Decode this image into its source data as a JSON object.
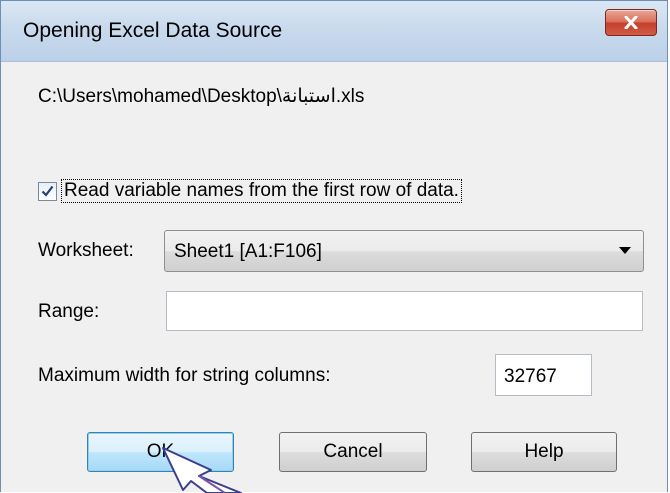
{
  "window": {
    "title": "Opening Excel Data Source",
    "close_icon": "close-x-icon"
  },
  "file": {
    "path": "C:\\Users\\mohamed\\Desktop\\استبانة.xls"
  },
  "options": {
    "read_var_names": {
      "label": "Read variable names from the first row of data.",
      "checked": true
    },
    "worksheet": {
      "label": "Worksheet:",
      "selected": "Sheet1  [A1:F106]"
    },
    "range": {
      "label": "Range:",
      "value": ""
    },
    "max_width": {
      "label": "Maximum width for string columns:",
      "value": "32767"
    }
  },
  "buttons": {
    "ok": "OK",
    "cancel": "Cancel",
    "help": "Help"
  },
  "colors": {
    "close_button": "#c7402b",
    "ok_button": "#bee6fd",
    "titlebar": "#c9daed"
  }
}
